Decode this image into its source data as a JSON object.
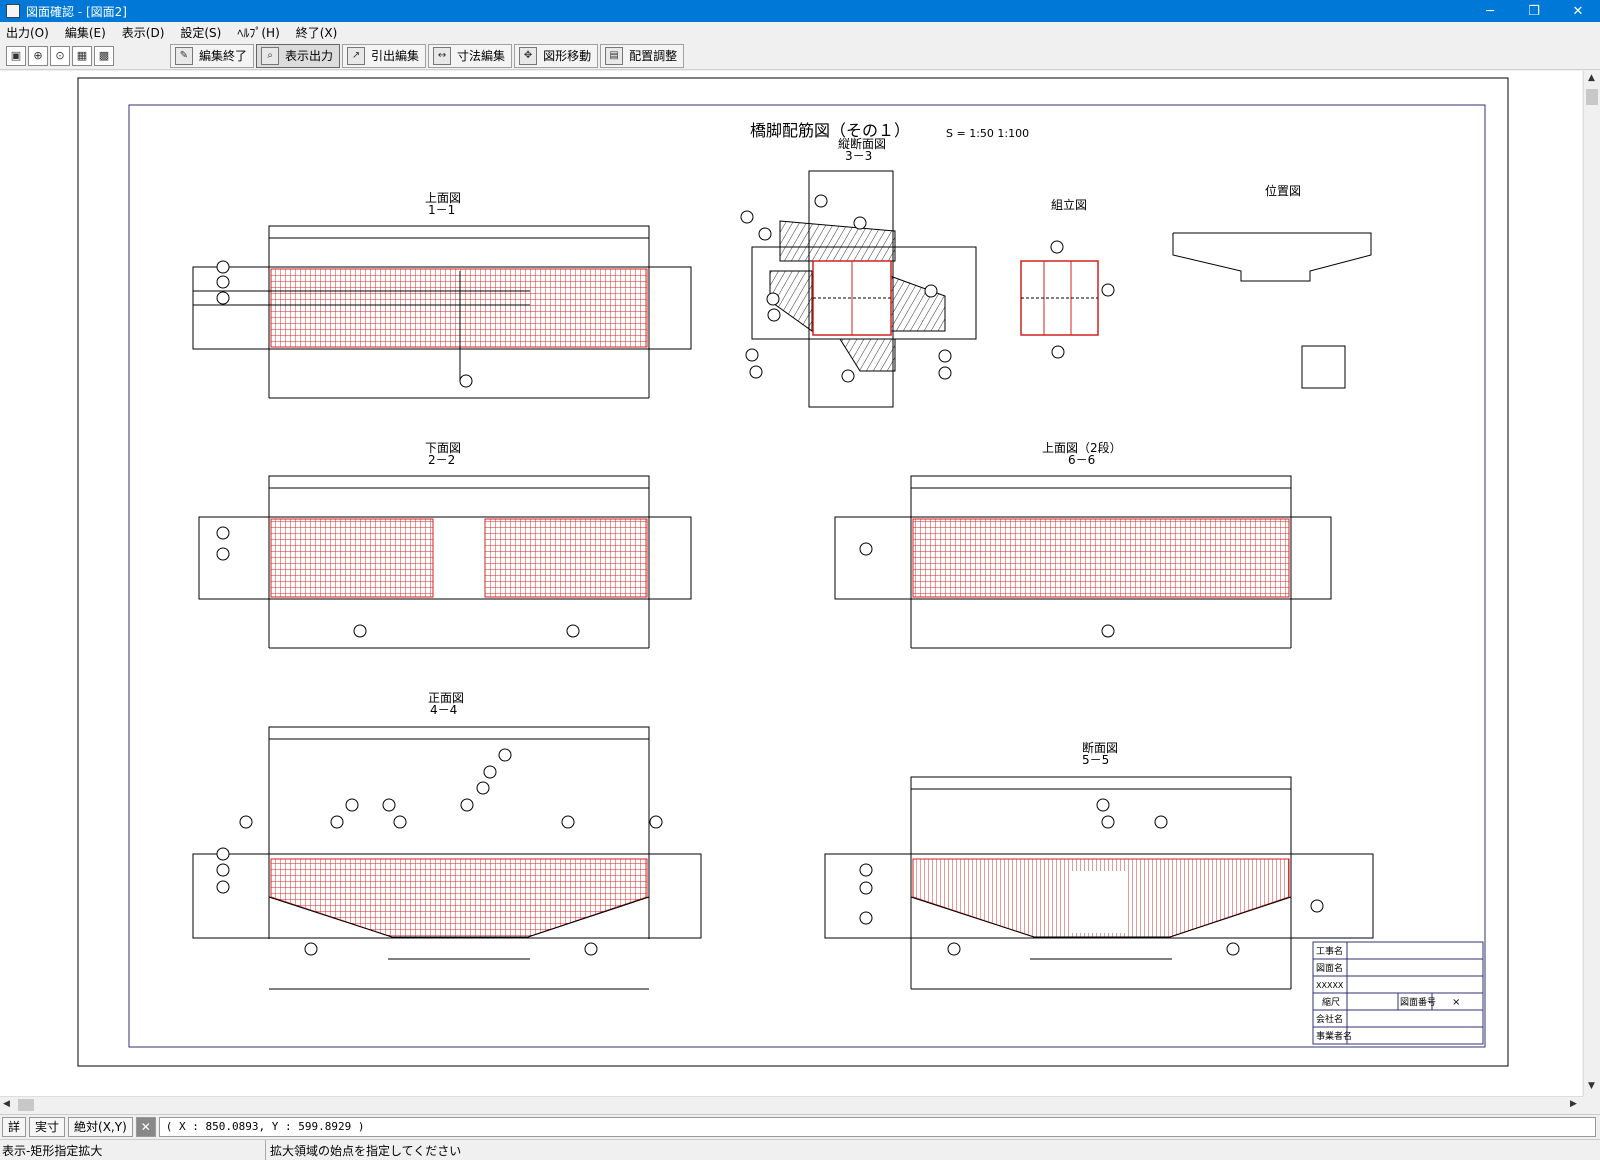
{
  "window": {
    "title": "図面確認 - [図面2]"
  },
  "menu": [
    {
      "label": "出力(O)"
    },
    {
      "label": "編集(E)"
    },
    {
      "label": "表示(D)"
    },
    {
      "label": "設定(S)"
    },
    {
      "label": "ﾍﾙﾌﾟ(H)"
    },
    {
      "label": "終了(X)"
    }
  ],
  "toolbar": {
    "buttons": [
      {
        "label": "編集終了"
      },
      {
        "label": "表示出力"
      },
      {
        "label": "引出編集"
      },
      {
        "label": "寸法編集"
      },
      {
        "label": "図形移動"
      },
      {
        "label": "配置調整"
      }
    ]
  },
  "drawing": {
    "title": "橋脚配筋図（その１）",
    "scale": "S =  1:50   1:100",
    "views": {
      "top1": {
        "name": "上面図",
        "sub": "1－1"
      },
      "longi": {
        "name": "縦断面図",
        "sub": "3－3"
      },
      "assembly": {
        "name": "組立図"
      },
      "position": {
        "name": "位置図"
      },
      "bottom2": {
        "name": "下面図",
        "sub": "2－2"
      },
      "top6": {
        "name": "上面図（2段）",
        "sub": "6－6"
      },
      "front4": {
        "name": "正面図",
        "sub": "4－4"
      },
      "section5": {
        "name": "断面図",
        "sub": "5－5"
      }
    },
    "titleblock": {
      "rows": [
        {
          "label": "工事名"
        },
        {
          "label": "図面名"
        },
        {
          "label": "XXXXX"
        },
        {
          "label": "縮尺",
          "mid": "図面番号",
          "right": "×"
        },
        {
          "label": "会社名"
        },
        {
          "label": "事業者名"
        }
      ]
    },
    "colors": {
      "rebar": "#d42020",
      "line": "#000000",
      "frame": "#303070"
    }
  },
  "status": {
    "mode1": "詳",
    "mode2": "実寸",
    "mode3": "絶対(X,Y)",
    "coords": "( X : 850.0893, Y : 599.8929 )",
    "left": "表示-矩形指定拡大",
    "message": "拡大領域の始点を指定してください"
  }
}
